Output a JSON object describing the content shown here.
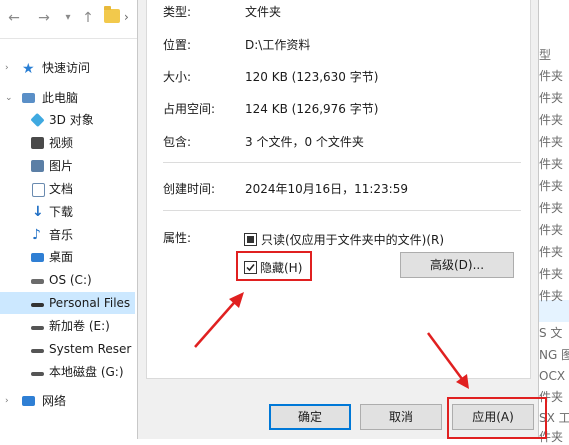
{
  "explorer": {
    "tree": [
      {
        "label": "快速访问",
        "icon": "star-icon",
        "color": "#2a7fd4"
      },
      {
        "label": "此电脑",
        "icon": "computer-icon",
        "color": "#5a8fc7"
      },
      {
        "label": "3D 对象",
        "icon": "cube-icon",
        "color": "#3fa9e0"
      },
      {
        "label": "视频",
        "icon": "video-icon",
        "color": "#4a4a4a"
      },
      {
        "label": "图片",
        "icon": "pictures-icon",
        "color": "#5b7fa6"
      },
      {
        "label": "文档",
        "icon": "documents-icon",
        "color": "#6a8bb0"
      },
      {
        "label": "下载",
        "icon": "download-icon",
        "color": "#1f6fc5"
      },
      {
        "label": "音乐",
        "icon": "music-icon",
        "color": "#1f6fc5"
      },
      {
        "label": "桌面",
        "icon": "desktop-icon",
        "color": "#2f7fd4"
      },
      {
        "label": "OS (C:)",
        "icon": "drive-icon",
        "color": "#6b6b6b"
      },
      {
        "label": "Personal Files",
        "icon": "drive-icon",
        "color": "#333333"
      },
      {
        "label": "新加卷 (E:)",
        "icon": "drive-icon",
        "color": "#555555"
      },
      {
        "label": "System Reser",
        "icon": "drive-icon",
        "color": "#555555"
      },
      {
        "label": "本地磁盘 (G:)",
        "icon": "drive-icon",
        "color": "#555555"
      },
      {
        "label": "网络",
        "icon": "network-icon",
        "color": "#2f7fd4"
      }
    ],
    "right_strip": [
      "型",
      "件夹",
      "件夹",
      "件夹",
      "件夹",
      "件夹",
      "件夹",
      "件夹",
      "件夹",
      "件夹",
      "件夹",
      "件夹",
      "S 文",
      "NG 图",
      "OCX 文",
      "件夹",
      "SX 工",
      "件夹"
    ]
  },
  "dialog": {
    "type_label": "类型:",
    "type_value": "文件夹",
    "location_label": "位置:",
    "location_value": "D:\\工作资料",
    "size_label": "大小:",
    "size_value": "120 KB (123,630 字节)",
    "disk_size_label": "占用空间:",
    "disk_size_value": "124 KB (126,976 字节)",
    "contains_label": "包含:",
    "contains_value": "3 个文件，0 个文件夹",
    "created_label": "创建时间:",
    "created_value": "2024年10月16日，11:23:59",
    "attributes_label": "属性:",
    "readonly_label": "只读(仅应用于文件夹中的文件)(R)",
    "hidden_label": "隐藏(H)",
    "advanced_label": "高级(D)...",
    "ok_label": "确定",
    "cancel_label": "取消",
    "apply_label": "应用(A)"
  },
  "annotation_color": "#e02020"
}
